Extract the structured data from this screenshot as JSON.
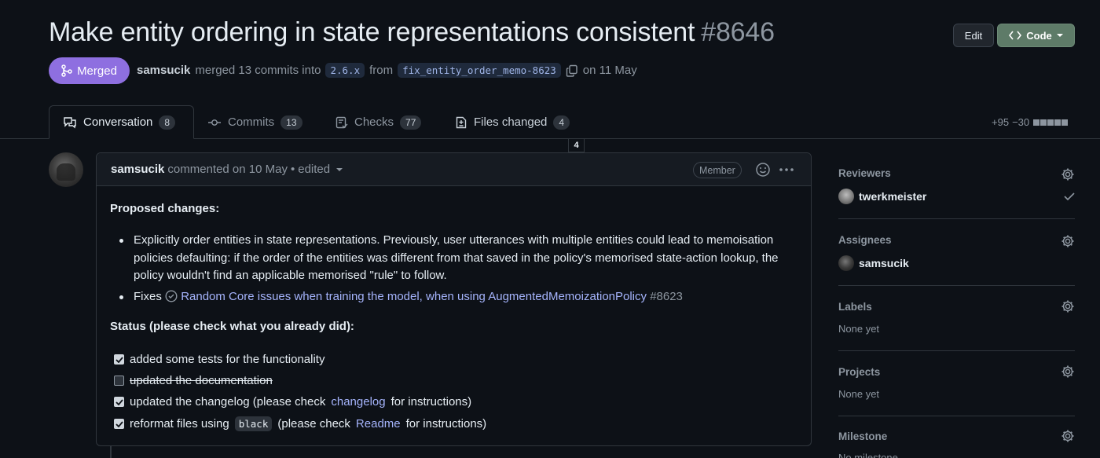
{
  "header": {
    "title": "Make entity ordering in state representations consistent",
    "number": "#8646",
    "edit_label": "Edit",
    "code_label": "Code"
  },
  "status": {
    "state_label": "Merged",
    "author": "samsucik",
    "merged_text": "merged 13 commits into",
    "base_branch": "2.6.x",
    "from_text": "from",
    "head_branch": "fix_entity_order_memo-8623",
    "date_text": "on 11 May"
  },
  "tabs": [
    {
      "label": "Conversation",
      "count": "8"
    },
    {
      "label": "Commits",
      "count": "13"
    },
    {
      "label": "Checks",
      "count": "77"
    },
    {
      "label": "Files changed",
      "count": "4"
    }
  ],
  "diffstat": {
    "additions": "+95",
    "deletions": "−30"
  },
  "files_tooltip": "4",
  "comment": {
    "author": "samsucik",
    "action": "commented on 10 May",
    "separator": "•",
    "edited": "edited",
    "role_badge": "Member",
    "heading": "Proposed changes:",
    "bullet1": "Explicitly order entities in state representations. Previously, user utterances with multiple entities could lead to memoisation policies defaulting: if the order of the entities was different from that saved in the policy's memorised state-action lookup, the policy wouldn't find an applicable memorised \"rule\" to follow.",
    "fixes_label": "Fixes",
    "issue_title": "Random Core issues when training the model, when using AugmentedMemoizationPolicy",
    "issue_number": "#8623",
    "status_heading": "Status (please check what you already did):",
    "tasks": [
      {
        "text": "added some tests for the functionality",
        "checked": true
      },
      {
        "text": "updated the documentation",
        "checked": false
      },
      {
        "text_before": "updated the changelog (please check",
        "link": "changelog",
        "text_after": "for instructions)",
        "checked": true
      },
      {
        "text_before": "reformat files using",
        "code": "black",
        "text_mid": "(please check",
        "link": "Readme",
        "text_after": "for instructions)",
        "checked": true
      }
    ]
  },
  "sidebar": {
    "reviewers_title": "Reviewers",
    "reviewer": "twerkmeister",
    "assignees_title": "Assignees",
    "assignee": "samsucik",
    "labels_title": "Labels",
    "labels_value": "None yet",
    "projects_title": "Projects",
    "projects_value": "None yet",
    "milestone_title": "Milestone",
    "milestone_value": "No milestone"
  }
}
